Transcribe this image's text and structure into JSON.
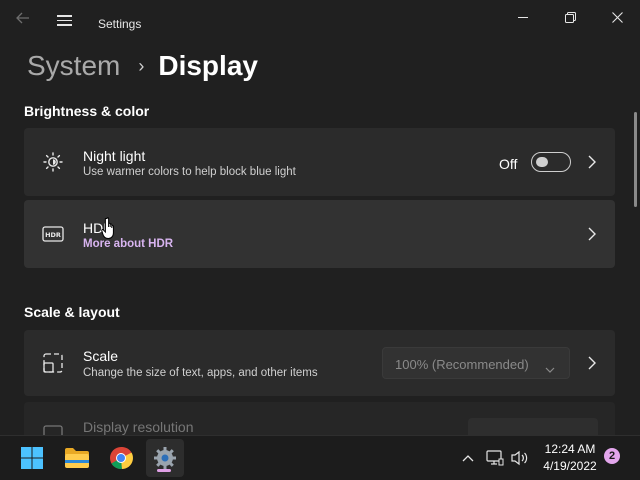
{
  "window": {
    "app_title": "Settings",
    "back_icon": "back-arrow-icon",
    "menu_icon": "hamburger-menu-icon"
  },
  "breadcrumb": {
    "parent": "System",
    "separator": "›",
    "current": "Display"
  },
  "sections": {
    "brightness_color": "Brightness & color",
    "scale_layout": "Scale & layout"
  },
  "night_light": {
    "title": "Night light",
    "description": "Use warmer colors to help block blue light",
    "toggle_label": "Off",
    "toggle_on": false,
    "icon": "brightness-icon"
  },
  "hdr": {
    "title": "HDR",
    "link": "More about HDR",
    "icon": "hdr-icon",
    "link_color": "#d8b4f0"
  },
  "scale": {
    "title": "Scale",
    "description": "Change the size of text, apps, and other items",
    "dropdown_value": "100% (Recommended)",
    "icon": "scale-icon"
  },
  "display_resolution": {
    "title": "Display resolution",
    "icon": "resolution-icon"
  },
  "taskbar": {
    "apps": [
      "start-icon",
      "file-explorer-icon",
      "chrome-icon",
      "settings-icon"
    ],
    "time": "12:24 AM",
    "date": "4/19/2022",
    "notification_count": "2"
  },
  "colors": {
    "background": "#202020",
    "card": "#2b2b2b",
    "accent_link": "#d8b4f0",
    "taskbar": "#1c1c1c",
    "badge": "#e3a6ec"
  }
}
